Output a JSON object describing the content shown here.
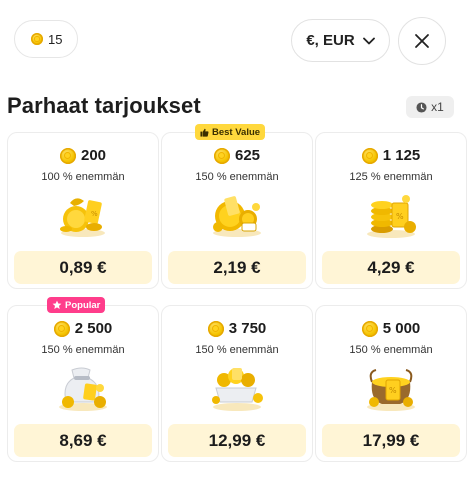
{
  "header": {
    "balance": "15",
    "currency_label": "€, EUR"
  },
  "section": {
    "title": "Parhaat tarjoukset",
    "timer_count": "x1"
  },
  "offers": [
    {
      "amount": "200",
      "bonus": "100 % enemmän",
      "price": "0,89 €",
      "tag": ""
    },
    {
      "amount": "625",
      "bonus": "150 % enemmän",
      "price": "2,19 €",
      "tag": "Best Value"
    },
    {
      "amount": "1 125",
      "bonus": "125 % enemmän",
      "price": "4,29 €",
      "tag": ""
    },
    {
      "amount": "2 500",
      "bonus": "150 % enemmän",
      "price": "8,69 €",
      "tag": "Popular"
    },
    {
      "amount": "3 750",
      "bonus": "150 % enemmän",
      "price": "12,99 €",
      "tag": ""
    },
    {
      "amount": "5 000",
      "bonus": "150 % enemmän",
      "price": "17,99 €",
      "tag": ""
    }
  ],
  "colors": {
    "price_bg": "#fff5d6",
    "best_value_tag": "#ffd83d",
    "popular_tag": "#ff3d8b",
    "coin": "#f5c400"
  },
  "icons": {
    "balance": "coin-icon",
    "currency": "chevron-down-icon",
    "close": "close-icon",
    "timer": "clock-icon",
    "best_value": "thumbs-up-icon",
    "popular": "star-icon"
  }
}
